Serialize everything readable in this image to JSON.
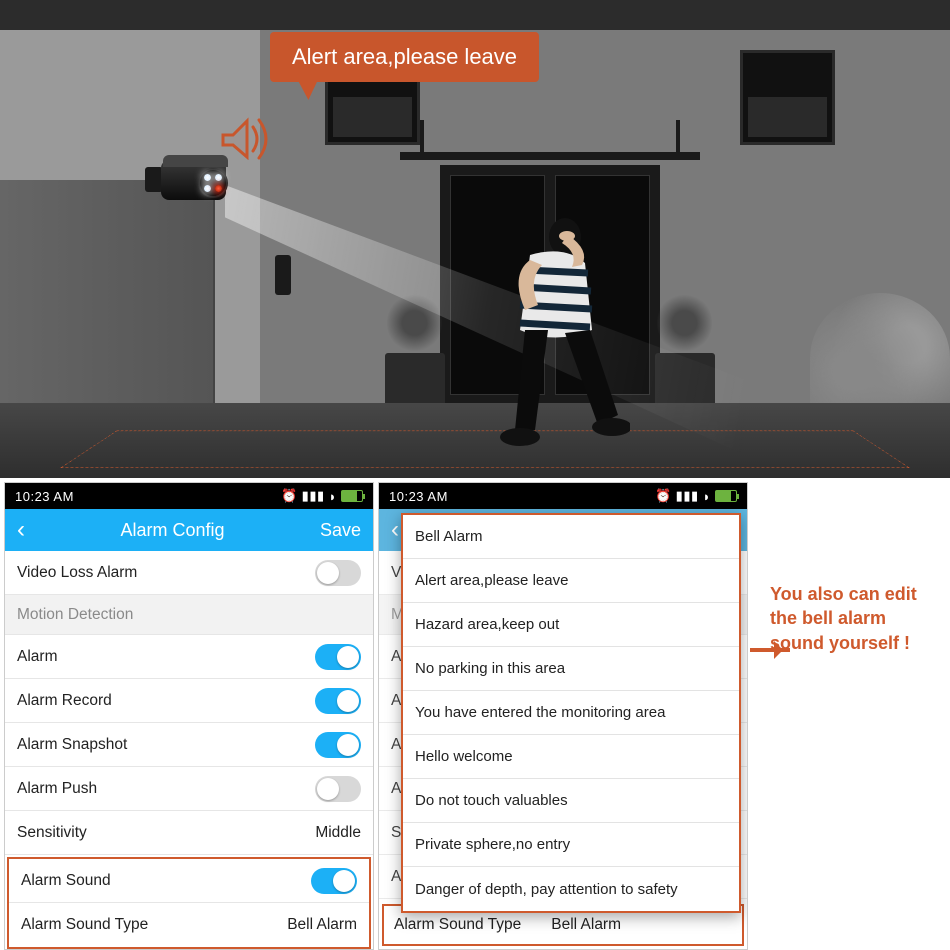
{
  "scene": {
    "bubble_text": "Alert area,please leave"
  },
  "colors": {
    "accent": "#c8562c",
    "header": "#1cb0f6"
  },
  "status": {
    "time": "10:23 AM",
    "battery_pct": 75
  },
  "header": {
    "title": "Alarm Config",
    "save": "Save"
  },
  "rows": {
    "video_loss": {
      "label": "Video Loss Alarm",
      "on": false
    },
    "section_motion": "Motion Detection",
    "alarm": {
      "label": "Alarm",
      "on": true
    },
    "alarm_record": {
      "label": "Alarm Record",
      "on": true
    },
    "alarm_snapshot": {
      "label": "Alarm Snapshot",
      "on": true
    },
    "alarm_push": {
      "label": "Alarm Push",
      "on": false
    },
    "sensitivity": {
      "label": "Sensitivity",
      "value": "Middle"
    },
    "alarm_sound": {
      "label": "Alarm Sound",
      "on": true
    },
    "alarm_sound_type": {
      "label": "Alarm Sound Type",
      "value": "Bell Alarm"
    }
  },
  "phone2_truncated": {
    "video": "Video",
    "motion": "Motio",
    "alarm": "Alarm",
    "sensit": "Sensit"
  },
  "dropdown": {
    "items": [
      "Bell Alarm",
      "Alert area,please leave",
      "Hazard area,keep out",
      "No parking in this area",
      "You have entered the monitoring area",
      "Hello welcome",
      "Do not touch valuables",
      "Private sphere,no entry",
      "Danger of depth, pay attention to safety"
    ]
  },
  "annotation": "You also can edit the bell alarm sound yourself !"
}
